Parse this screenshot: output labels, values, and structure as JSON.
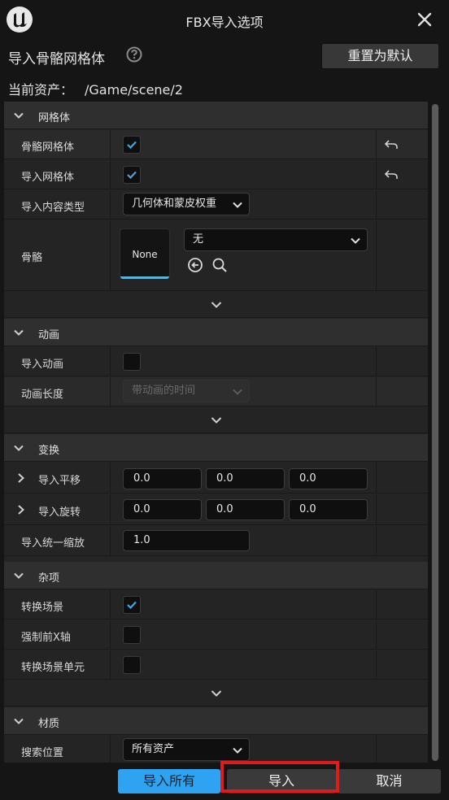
{
  "window": {
    "title": "FBX导入选项"
  },
  "header": {
    "title": "导入骨骼网格体",
    "reset_label": "重置为默认"
  },
  "asset": {
    "label": "当前资产：",
    "path": "/Game/scene/2"
  },
  "sections": {
    "mesh": {
      "title": "网格体",
      "skeletal_mesh": {
        "label": "骨骼网格体",
        "checked": true
      },
      "import_mesh": {
        "label": "导入网格体",
        "checked": true
      },
      "content_type": {
        "label": "导入内容类型",
        "value": "几何体和蒙皮权重"
      },
      "skeleton": {
        "label": "骨骼",
        "thumbnail": "None",
        "value": "无"
      }
    },
    "animation": {
      "title": "动画",
      "import_anim": {
        "label": "导入动画",
        "checked": false
      },
      "anim_length": {
        "label": "动画长度",
        "value": "带动画的时间"
      }
    },
    "transform": {
      "title": "变换",
      "translation": {
        "label": "导入平移",
        "x": "0.0",
        "y": "0.0",
        "z": "0.0"
      },
      "rotation": {
        "label": "导入旋转",
        "x": "0.0",
        "y": "0.0",
        "z": "0.0"
      },
      "uniform_scale": {
        "label": "导入统一缩放",
        "value": "1.0"
      }
    },
    "misc": {
      "title": "杂项",
      "convert_scene": {
        "label": "转换场景",
        "checked": true
      },
      "force_front_x": {
        "label": "强制前X轴",
        "checked": false
      },
      "convert_scene_unit": {
        "label": "转换场景单元",
        "checked": false
      }
    },
    "material": {
      "title": "材质",
      "search_location": {
        "label": "搜索位置",
        "value": "所有资产"
      }
    }
  },
  "buttons": {
    "import_all": "导入所有",
    "import": "导入",
    "cancel": "取消"
  },
  "colors": {
    "accent": "#2ea3f2",
    "highlight": "#e01b1b",
    "check": "#4aa3d8"
  }
}
